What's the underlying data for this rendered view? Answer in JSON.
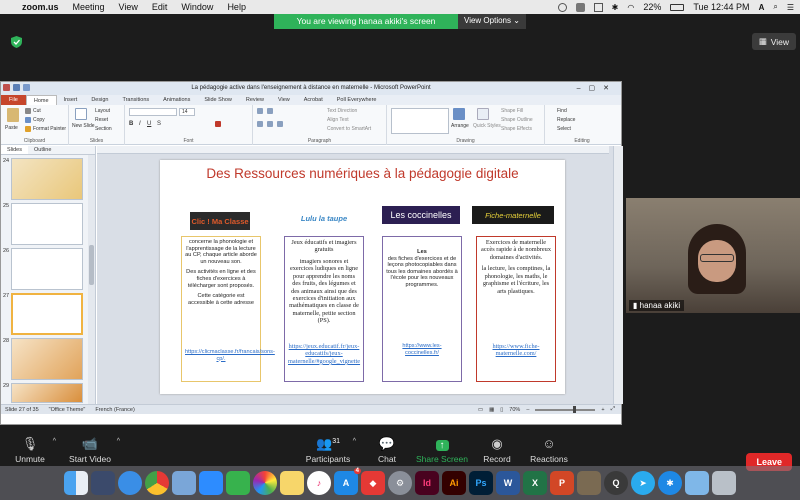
{
  "menubar": {
    "app": "zoom.us",
    "items": [
      "Meeting",
      "View",
      "Edit",
      "Window",
      "Help"
    ],
    "battery": "22%",
    "clock": "Tue 12:44 PM"
  },
  "zoom": {
    "banner": "You are viewing hanaa akiki's screen",
    "view_options": "View Options",
    "view_button": "View",
    "participant_name": "hanaa akiki",
    "toolbar": {
      "unmute": "Unmute",
      "start_video": "Start Video",
      "participants": "Participants",
      "participants_count": "31",
      "chat": "Chat",
      "share_screen": "Share Screen",
      "record": "Record",
      "reactions": "Reactions",
      "leave": "Leave"
    }
  },
  "ppt": {
    "window_title": "La pédagogie active  dans l'enseignement à distance  en maternelle  -  Microsoft PowerPoint",
    "tabs": [
      "File",
      "Home",
      "Insert",
      "Design",
      "Transitions",
      "Animations",
      "Slide Show",
      "Review",
      "View",
      "Acrobat",
      "Poll Everywhere"
    ],
    "ribbon": {
      "paste": "Paste",
      "cut": "Cut",
      "copy": "Copy",
      "format_painter": "Format Painter",
      "clipboard": "Clipboard",
      "new_slide": "New Slide",
      "layout": "Layout",
      "reset": "Reset",
      "section": "Section",
      "slides": "Slides",
      "font_size": "14",
      "font": "Font",
      "paragraph": "Paragraph",
      "text_direction": "Text Direction",
      "align_text": "Align Text",
      "convert_smartart": "Convert to SmartArt",
      "drawing": "Drawing",
      "arrange": "Arrange",
      "quick_styles": "Quick Styles",
      "shape_fill": "Shape Fill",
      "shape_outline": "Shape Outline",
      "shape_effects": "Shape Effects",
      "find": "Find",
      "replace": "Replace",
      "select": "Select",
      "editing": "Editing"
    },
    "pane_tabs": [
      "Slides",
      "Outline"
    ],
    "thumb_numbers": [
      "24",
      "25",
      "26",
      "27",
      "28",
      "29"
    ],
    "status": {
      "slide": "Slide 27 of 35",
      "theme": "\"Office Theme\"",
      "language": "French (France)",
      "zoom": "70%"
    },
    "slide": {
      "title": "Des Ressources numériques à la pédagogie digitale",
      "logos": [
        "Clic ! Ma Classe",
        "Lulu la taupe",
        "Les coccinelles",
        "Fiche-maternelle"
      ],
      "col1": {
        "p1": "concerne la phonologie et l'apprentissage de la lecture au CP, chaque article aborde un nouveau  son.",
        "p2": "Des activités en ligne et des fiches d'exercices à télécharger sont proposés.",
        "p3": "Cette catégorie est accessible à cette adresse",
        "link": "https://clicmaclasse.fr/francais/sons-cp/."
      },
      "col2": {
        "p1": "Jeux éducatifs et imagiers gratuits",
        "p2": "imagiers sonores et exercices ludiques en ligne pour apprendre les noms des fruits, des légumes et des animaux ainsi que des exercices d'initiation aux mathématiques en classe de maternelle, petite section (PS).",
        "link": "https://jeux.educatif.fr/jeux-educatifs/jeux-maternelle/#google_vignette"
      },
      "col3": {
        "p1": "Les",
        "p2": "des fiches d'exercices et de leçons photocopiables dans tous les domaines abordés à l'école pour les nouveaux programmes.",
        "link": "https://www.les-coccinelles.fr/"
      },
      "col4": {
        "p1": "Exercices de maternelle accès rapide à de nombreux domaines d'activités.",
        "p2": "la lecture, les comptines, la phonologie, les maths, le graphisme et l'écriture, les arts plastiques.",
        "link": "https://www.fiche-maternelle.com/"
      }
    }
  },
  "dock": {
    "apps": [
      "finder",
      "launchpad",
      "safari",
      "chrome",
      "preview",
      "zoom",
      "facetime",
      "photos",
      "notes",
      "itunes",
      "app-store",
      "anydesk",
      "system-preferences",
      "indesign",
      "illustrator",
      "photoshop",
      "word",
      "excel",
      "powerpoint",
      "gimp",
      "quicktime",
      "telegram",
      "accessibility",
      "folder",
      "trash"
    ],
    "app_store_badge": "4"
  }
}
